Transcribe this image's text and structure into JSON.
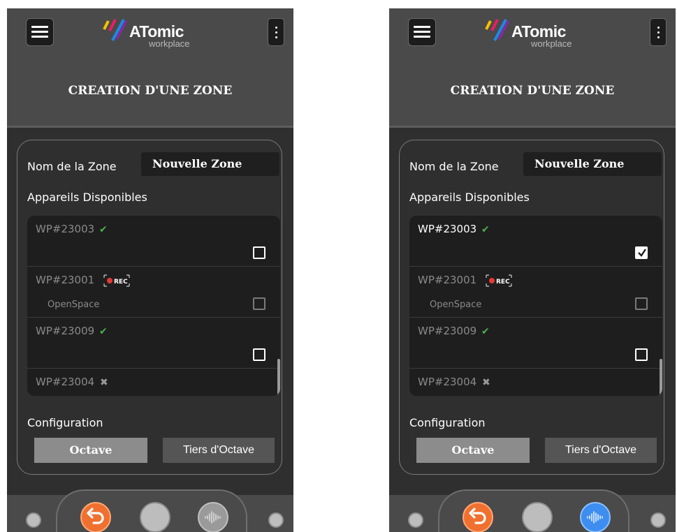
{
  "screens": [
    {
      "logo": {
        "word": "ATomic",
        "sub": "workplace"
      },
      "title": "CREATION D'UNE ZONE",
      "zone": {
        "label": "Nom de la Zone",
        "value": "Nouvelle Zone"
      },
      "devices_label": "Appareils Disponibles",
      "devices": [
        {
          "name": "WP#23003",
          "status": "ok",
          "sub": "",
          "checked": false
        },
        {
          "name": "WP#23001",
          "status": "rec",
          "rec_text": "REC",
          "sub": "OpenSpace",
          "checked": false
        },
        {
          "name": "WP#23009",
          "status": "ok",
          "sub": "",
          "checked": false
        },
        {
          "name": "WP#23004",
          "status": "off",
          "sub": "",
          "checked": false
        }
      ],
      "config_label": "Configuration",
      "config_options": [
        "Octave",
        "Tiers d'Octave"
      ],
      "config_selected": "Octave",
      "wave_active": false
    },
    {
      "logo": {
        "word": "ATomic",
        "sub": "workplace"
      },
      "title": "CREATION D'UNE ZONE",
      "zone": {
        "label": "Nom de la Zone",
        "value": "Nouvelle Zone"
      },
      "devices_label": "Appareils Disponibles",
      "devices": [
        {
          "name": "WP#23003",
          "status": "ok",
          "sub": "",
          "checked": true
        },
        {
          "name": "WP#23001",
          "status": "rec",
          "rec_text": "REC",
          "sub": "OpenSpace",
          "checked": false
        },
        {
          "name": "WP#23009",
          "status": "ok",
          "sub": "",
          "checked": false
        },
        {
          "name": "WP#23004",
          "status": "off",
          "sub": "",
          "checked": false
        }
      ],
      "config_label": "Configuration",
      "config_options": [
        "Octave",
        "Tiers d'Octave"
      ],
      "config_selected": "Octave",
      "wave_active": true
    }
  ],
  "icons": {
    "menu": "hamburger-icon",
    "more": "kebab-icon",
    "ok": "check-icon",
    "off": "cross-icon",
    "rec": "rec-badge-icon",
    "undo": "undo-icon",
    "home": "home-icon",
    "wave": "waveform-icon"
  },
  "colors": {
    "header": "#4a4a4a",
    "background": "#2f2f2f",
    "ok": "#4caf50",
    "undo": "#f07030",
    "wave_active": "#3d8ef0",
    "rec": "#e53935"
  }
}
